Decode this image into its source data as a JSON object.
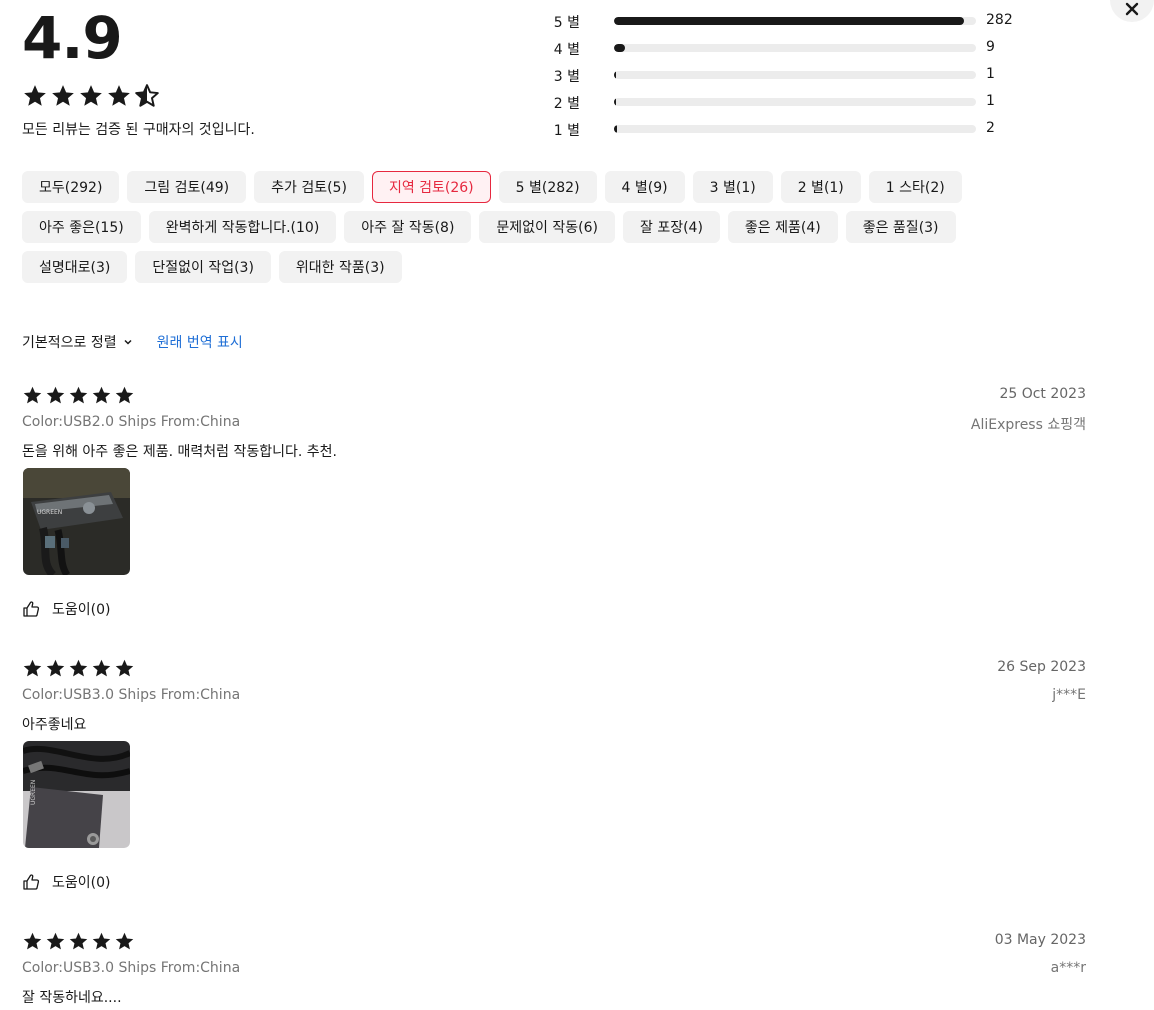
{
  "summary": {
    "rating": "4.9",
    "stars": 4.5,
    "note": "모든 리뷰는 검증 된 구매자의 것입니다."
  },
  "distribution": [
    {
      "label": "5 별",
      "count": "282",
      "fraction": 0.966
    },
    {
      "label": "4 별",
      "count": "9",
      "fraction": 0.031
    },
    {
      "label": "3 별",
      "count": "1",
      "fraction": 0.003
    },
    {
      "label": "2 별",
      "count": "1",
      "fraction": 0.003
    },
    {
      "label": "1 별",
      "count": "2",
      "fraction": 0.007
    }
  ],
  "filters": [
    {
      "label": "모두(292)",
      "active": false
    },
    {
      "label": "그림 검토(49)",
      "active": false
    },
    {
      "label": "추가 검토(5)",
      "active": false
    },
    {
      "label": "지역 검토(26)",
      "active": true
    },
    {
      "label": "5 별(282)",
      "active": false
    },
    {
      "label": "4 별(9)",
      "active": false
    },
    {
      "label": "3 별(1)",
      "active": false
    },
    {
      "label": "2 별(1)",
      "active": false
    },
    {
      "label": "1 스타(2)",
      "active": false
    },
    {
      "label": "아주 좋은(15)",
      "active": false
    },
    {
      "label": "완벽하게 작동합니다.(10)",
      "active": false
    },
    {
      "label": "아주 잘 작동(8)",
      "active": false
    },
    {
      "label": "문제없이 작동(6)",
      "active": false
    },
    {
      "label": "잘 포장(4)",
      "active": false
    },
    {
      "label": "좋은 제품(4)",
      "active": false
    },
    {
      "label": "좋은 품질(3)",
      "active": false
    },
    {
      "label": "설명대로(3)",
      "active": false
    },
    {
      "label": "단절없이 작업(3)",
      "active": false
    },
    {
      "label": "위대한 작품(3)",
      "active": false
    }
  ],
  "sort": {
    "label": "기본적으로 정렬",
    "show_original": "원래 번역 표시"
  },
  "reviews": [
    {
      "stars": 5,
      "date": "25 Oct 2023",
      "meta": "Color:USB2.0 Ships From:China",
      "author": "AliExpress 쇼핑객",
      "text": "돈을 위해 아주 좋은 제품. 매력처럼 작동합니다. 추천.",
      "has_photo": true,
      "photo_brand": "UGREEN",
      "helpful": "도움이(0)"
    },
    {
      "stars": 5,
      "date": "26 Sep 2023",
      "meta": "Color:USB3.0 Ships From:China",
      "author": "j***E",
      "text": "아주좋네요",
      "has_photo": true,
      "photo_brand": "UGREEN",
      "helpful": "도움이(0)"
    },
    {
      "stars": 5,
      "date": "03 May 2023",
      "meta": "Color:USB3.0 Ships From:China",
      "author": "a***r",
      "text": "잘 작동하네요....",
      "has_photo": false,
      "helpful": ""
    }
  ],
  "colors": {
    "accent": "#e6283f",
    "link": "#1f6fd6",
    "bar_fill": "#191919",
    "bar_track": "#ececec"
  }
}
